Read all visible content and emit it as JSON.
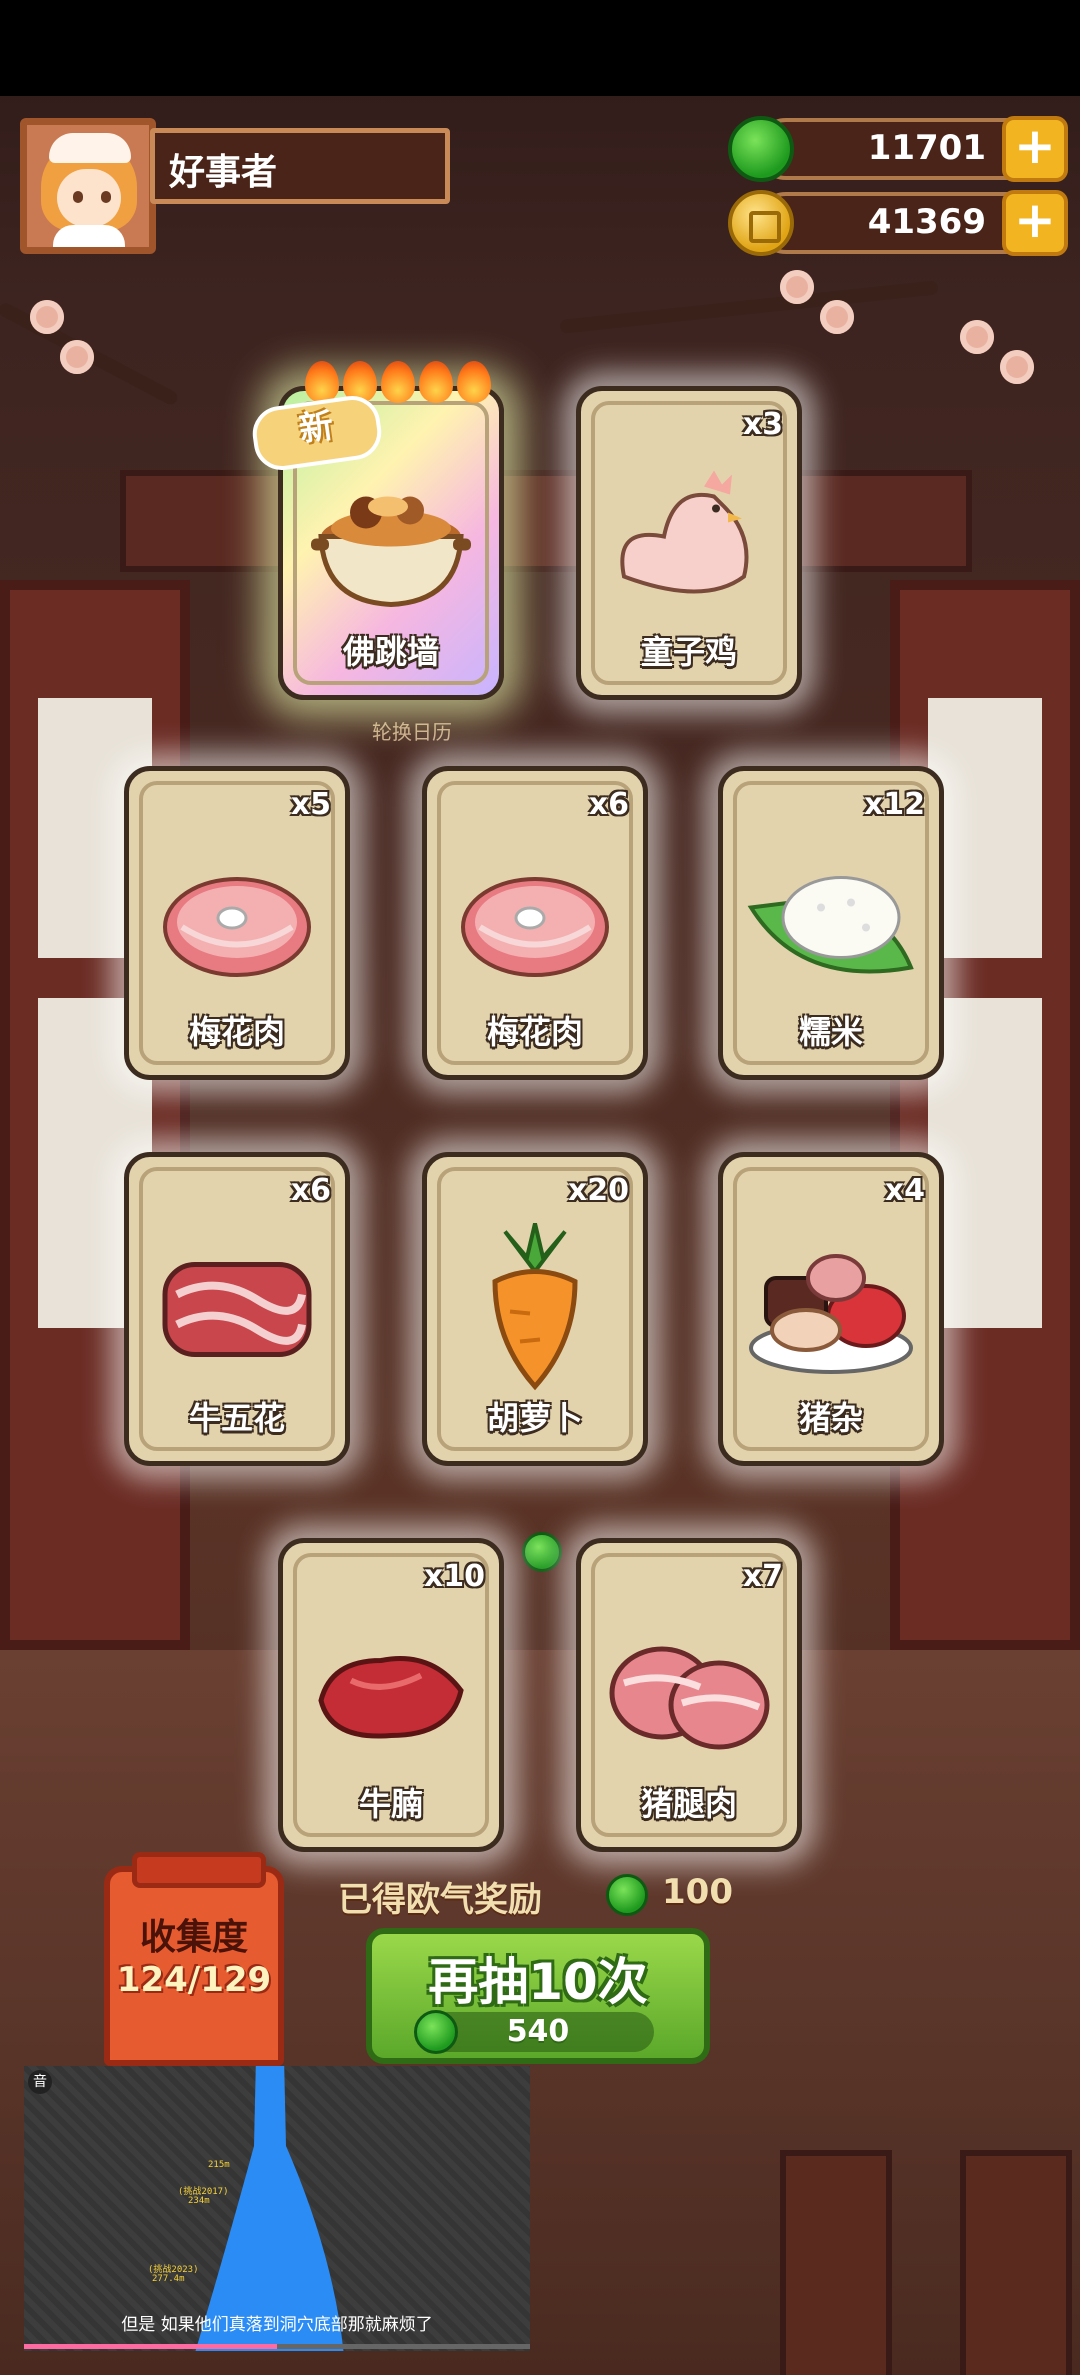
{
  "player": {
    "name": "好事者"
  },
  "currency": {
    "gems": "11701",
    "coins": "41369"
  },
  "cards": [
    {
      "name": "佛跳墙",
      "count": "",
      "is_new": true,
      "new_label": "新",
      "stars": 5
    },
    {
      "name": "童子鸡",
      "count": "x3"
    },
    {
      "name": "梅花肉",
      "count": "x5"
    },
    {
      "name": "梅花肉",
      "count": "x6"
    },
    {
      "name": "糯米",
      "count": "x12"
    },
    {
      "name": "牛五花",
      "count": "x6"
    },
    {
      "name": "胡萝卜",
      "count": "x20"
    },
    {
      "name": "猪杂",
      "count": "x4"
    },
    {
      "name": "牛腩",
      "count": "x10"
    },
    {
      "name": "猪腿肉",
      "count": "x7"
    }
  ],
  "background_text": "轮换日历",
  "collection": {
    "label": "收集度",
    "value": "124/129"
  },
  "reward": {
    "label": "已得欧气奖励",
    "value": "100"
  },
  "draw_button": {
    "label": "再抽10次",
    "cost": "540"
  },
  "video": {
    "badge": "音",
    "subtitle": "但是 如果他们真落到洞穴底部那就麻烦了",
    "depth_labels": [
      "215m",
      "(挑战2017)",
      "234m",
      "(挑战2023)",
      "277.4m"
    ],
    "progress": 0.5
  },
  "colors": {
    "gem": "#1e9a1e",
    "coin": "#e0a414",
    "plus_button": "#f2b521",
    "draw_button": "#5ba82a",
    "collection_jar": "#e65b30"
  }
}
